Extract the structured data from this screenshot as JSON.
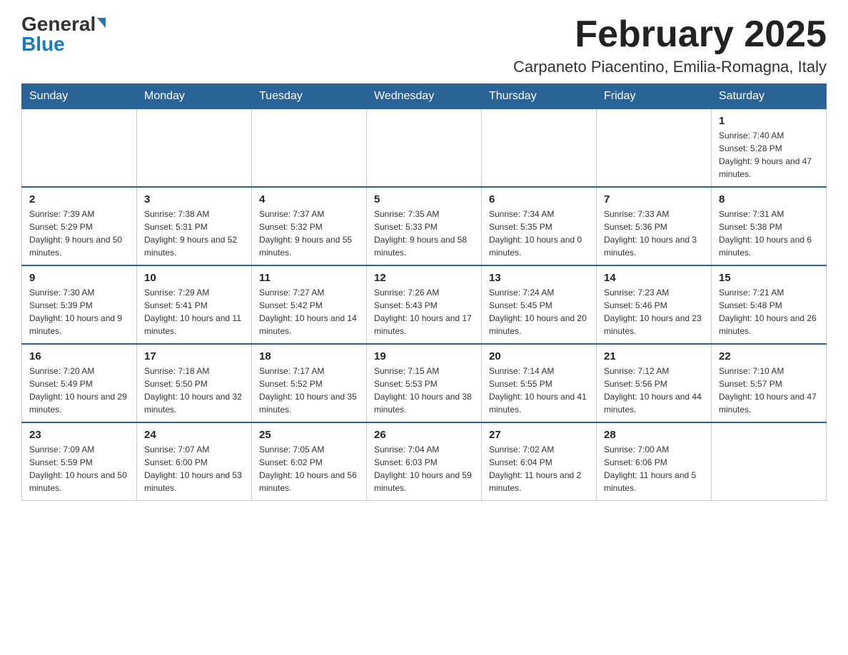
{
  "logo": {
    "general": "General",
    "blue": "Blue"
  },
  "title": {
    "month": "February 2025",
    "location": "Carpaneto Piacentino, Emilia-Romagna, Italy"
  },
  "days_of_week": [
    "Sunday",
    "Monday",
    "Tuesday",
    "Wednesday",
    "Thursday",
    "Friday",
    "Saturday"
  ],
  "weeks": [
    [
      {
        "day": "",
        "info": ""
      },
      {
        "day": "",
        "info": ""
      },
      {
        "day": "",
        "info": ""
      },
      {
        "day": "",
        "info": ""
      },
      {
        "day": "",
        "info": ""
      },
      {
        "day": "",
        "info": ""
      },
      {
        "day": "1",
        "info": "Sunrise: 7:40 AM\nSunset: 5:28 PM\nDaylight: 9 hours and 47 minutes."
      }
    ],
    [
      {
        "day": "2",
        "info": "Sunrise: 7:39 AM\nSunset: 5:29 PM\nDaylight: 9 hours and 50 minutes."
      },
      {
        "day": "3",
        "info": "Sunrise: 7:38 AM\nSunset: 5:31 PM\nDaylight: 9 hours and 52 minutes."
      },
      {
        "day": "4",
        "info": "Sunrise: 7:37 AM\nSunset: 5:32 PM\nDaylight: 9 hours and 55 minutes."
      },
      {
        "day": "5",
        "info": "Sunrise: 7:35 AM\nSunset: 5:33 PM\nDaylight: 9 hours and 58 minutes."
      },
      {
        "day": "6",
        "info": "Sunrise: 7:34 AM\nSunset: 5:35 PM\nDaylight: 10 hours and 0 minutes."
      },
      {
        "day": "7",
        "info": "Sunrise: 7:33 AM\nSunset: 5:36 PM\nDaylight: 10 hours and 3 minutes."
      },
      {
        "day": "8",
        "info": "Sunrise: 7:31 AM\nSunset: 5:38 PM\nDaylight: 10 hours and 6 minutes."
      }
    ],
    [
      {
        "day": "9",
        "info": "Sunrise: 7:30 AM\nSunset: 5:39 PM\nDaylight: 10 hours and 9 minutes."
      },
      {
        "day": "10",
        "info": "Sunrise: 7:29 AM\nSunset: 5:41 PM\nDaylight: 10 hours and 11 minutes."
      },
      {
        "day": "11",
        "info": "Sunrise: 7:27 AM\nSunset: 5:42 PM\nDaylight: 10 hours and 14 minutes."
      },
      {
        "day": "12",
        "info": "Sunrise: 7:26 AM\nSunset: 5:43 PM\nDaylight: 10 hours and 17 minutes."
      },
      {
        "day": "13",
        "info": "Sunrise: 7:24 AM\nSunset: 5:45 PM\nDaylight: 10 hours and 20 minutes."
      },
      {
        "day": "14",
        "info": "Sunrise: 7:23 AM\nSunset: 5:46 PM\nDaylight: 10 hours and 23 minutes."
      },
      {
        "day": "15",
        "info": "Sunrise: 7:21 AM\nSunset: 5:48 PM\nDaylight: 10 hours and 26 minutes."
      }
    ],
    [
      {
        "day": "16",
        "info": "Sunrise: 7:20 AM\nSunset: 5:49 PM\nDaylight: 10 hours and 29 minutes."
      },
      {
        "day": "17",
        "info": "Sunrise: 7:18 AM\nSunset: 5:50 PM\nDaylight: 10 hours and 32 minutes."
      },
      {
        "day": "18",
        "info": "Sunrise: 7:17 AM\nSunset: 5:52 PM\nDaylight: 10 hours and 35 minutes."
      },
      {
        "day": "19",
        "info": "Sunrise: 7:15 AM\nSunset: 5:53 PM\nDaylight: 10 hours and 38 minutes."
      },
      {
        "day": "20",
        "info": "Sunrise: 7:14 AM\nSunset: 5:55 PM\nDaylight: 10 hours and 41 minutes."
      },
      {
        "day": "21",
        "info": "Sunrise: 7:12 AM\nSunset: 5:56 PM\nDaylight: 10 hours and 44 minutes."
      },
      {
        "day": "22",
        "info": "Sunrise: 7:10 AM\nSunset: 5:57 PM\nDaylight: 10 hours and 47 minutes."
      }
    ],
    [
      {
        "day": "23",
        "info": "Sunrise: 7:09 AM\nSunset: 5:59 PM\nDaylight: 10 hours and 50 minutes."
      },
      {
        "day": "24",
        "info": "Sunrise: 7:07 AM\nSunset: 6:00 PM\nDaylight: 10 hours and 53 minutes."
      },
      {
        "day": "25",
        "info": "Sunrise: 7:05 AM\nSunset: 6:02 PM\nDaylight: 10 hours and 56 minutes."
      },
      {
        "day": "26",
        "info": "Sunrise: 7:04 AM\nSunset: 6:03 PM\nDaylight: 10 hours and 59 minutes."
      },
      {
        "day": "27",
        "info": "Sunrise: 7:02 AM\nSunset: 6:04 PM\nDaylight: 11 hours and 2 minutes."
      },
      {
        "day": "28",
        "info": "Sunrise: 7:00 AM\nSunset: 6:06 PM\nDaylight: 11 hours and 5 minutes."
      },
      {
        "day": "",
        "info": ""
      }
    ]
  ]
}
